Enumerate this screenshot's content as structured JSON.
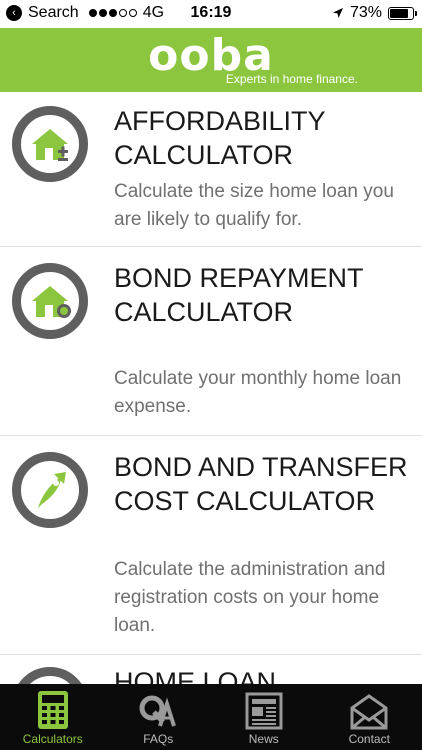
{
  "status_bar": {
    "back_app": "Search",
    "carrier": "4G",
    "time": "16:19",
    "battery_percent": "73%",
    "battery_level": 0.73,
    "signal_bars_on": 3,
    "signal_bars_total": 5
  },
  "header": {
    "logo": "ooba",
    "tagline": "Experts in home finance.",
    "background": "#8cc63f"
  },
  "calculators": [
    {
      "title": "AFFORDABILITY CALCULATOR",
      "description": "Calculate the size home loan you are likely to qualify for.",
      "icon": "house-plus-minus-icon"
    },
    {
      "title": "BOND REPAYMENT CALCULATOR",
      "description": "Calculate your monthly home loan expense.",
      "icon": "house-coin-icon"
    },
    {
      "title": "BOND AND TRANSFER COST CALCULATOR",
      "description": "Calculate the administration and registration costs on your home loan.",
      "icon": "rocket-leaf-icon"
    },
    {
      "title": "HOME LOAN",
      "description": "",
      "icon": "ring-icon"
    }
  ],
  "tabs": [
    {
      "label": "Calculators",
      "icon": "calculator-icon",
      "active": true
    },
    {
      "label": "FAQs",
      "icon": "qa-icon",
      "active": false
    },
    {
      "label": "News",
      "icon": "newspaper-icon",
      "active": false
    },
    {
      "label": "Contact",
      "icon": "envelope-icon",
      "active": false
    }
  ],
  "colors": {
    "accent": "#8cc63f",
    "ring": "#5f5f5f",
    "tabbar": "#0b0b0b"
  }
}
